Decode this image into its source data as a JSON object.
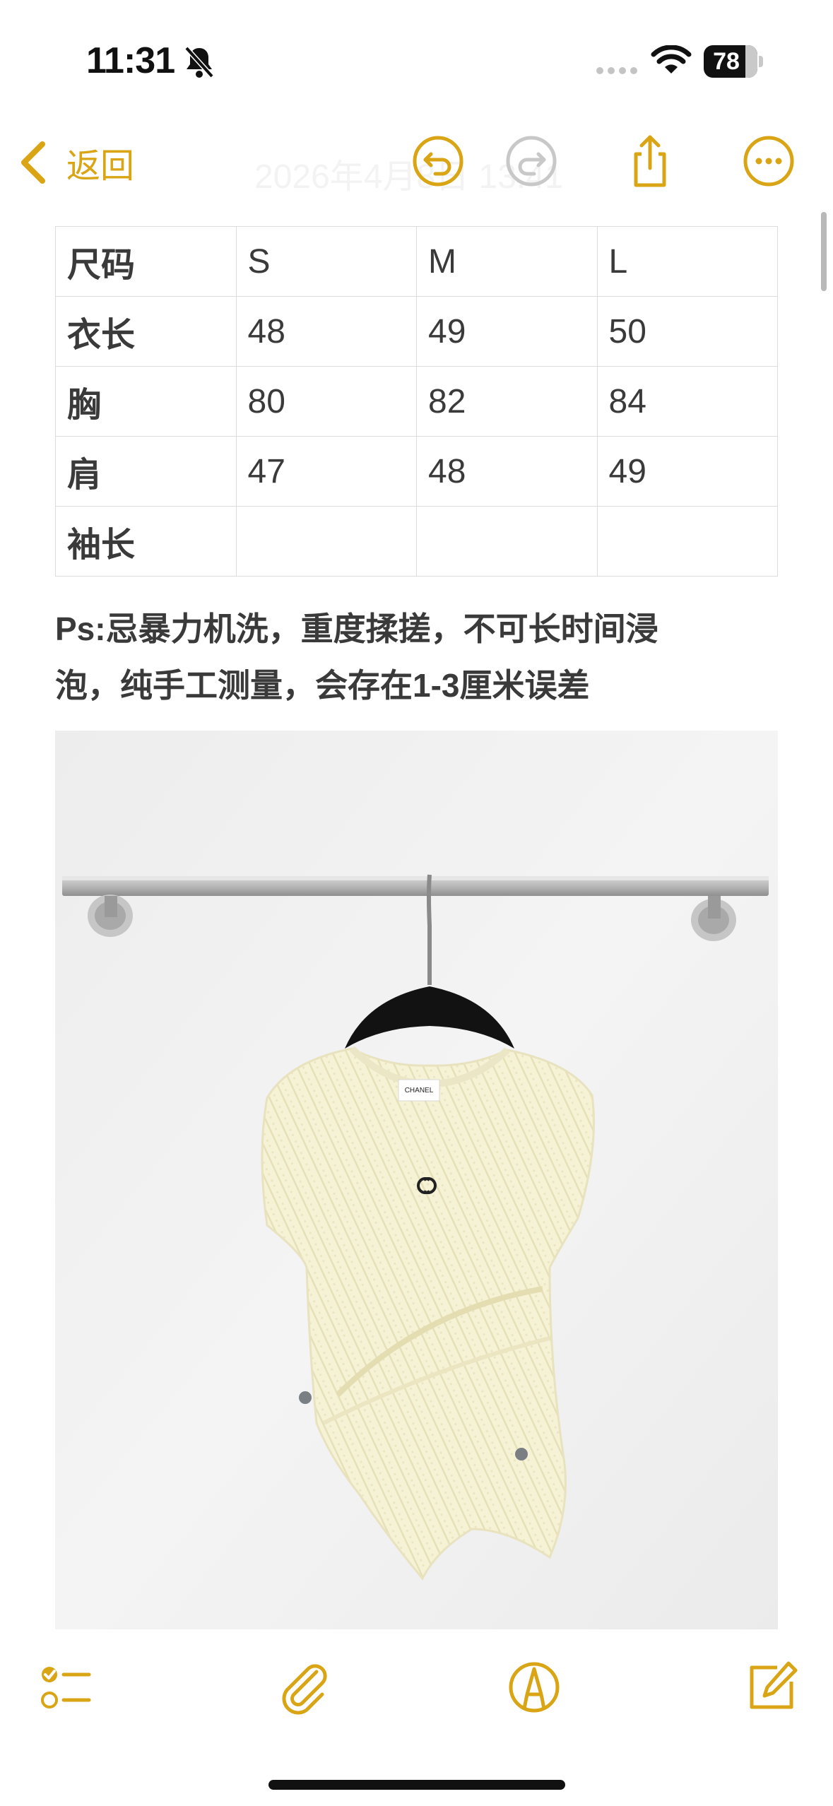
{
  "status_bar": {
    "time": "11:31",
    "battery": "78",
    "battery_level": 0.78
  },
  "nav": {
    "back_label": "返回",
    "title": "2026年4月8日 13:41"
  },
  "table": {
    "header": [
      "尺码",
      "S",
      "M",
      "L"
    ],
    "rows": [
      [
        "衣长",
        "48",
        "49",
        "50"
      ],
      [
        "胸",
        "80",
        "82",
        "84"
      ],
      [
        "肩",
        "47",
        "48",
        "49"
      ],
      [
        "袖长",
        "",
        "",
        ""
      ]
    ]
  },
  "note": {
    "line1": "Ps:忌暴力机洗，重度揉搓，不可长时间浸",
    "line2": "泡，纯手工测量，会存在1-3厘米误差"
  },
  "photo": {
    "label_text": "CHANEL"
  },
  "icons": {
    "back": "chevron-left-icon",
    "undo": "undo-icon",
    "redo": "redo-icon",
    "share": "share-icon",
    "more": "more-icon",
    "checklist": "checklist-icon",
    "attach": "paperclip-icon",
    "markup": "markup-pen-icon",
    "compose": "compose-icon"
  },
  "colors": {
    "accent": "#d9a514",
    "disabled": "#c8c8c8",
    "text": "#3a3a3a"
  }
}
